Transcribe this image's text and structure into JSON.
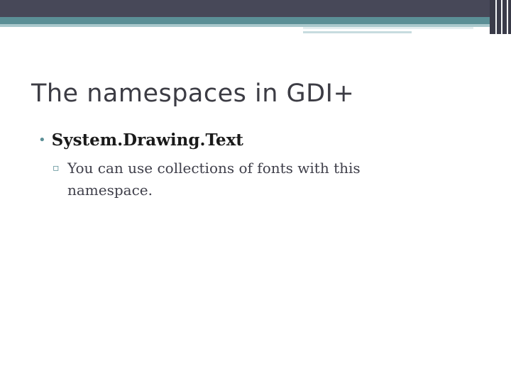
{
  "slide": {
    "title": "The namespaces in GDI+",
    "bullets": [
      {
        "marker": "•",
        "text": "System.Drawing.Text",
        "sub_bullets": [
          {
            "marker": "▫",
            "text": "You can use collections of fonts with this namespace."
          }
        ]
      }
    ]
  },
  "colors": {
    "header_dark": "#474858",
    "header_teal": "#5b8f96",
    "title_text": "#3c3c44",
    "body_text": "#3f3f4a"
  }
}
